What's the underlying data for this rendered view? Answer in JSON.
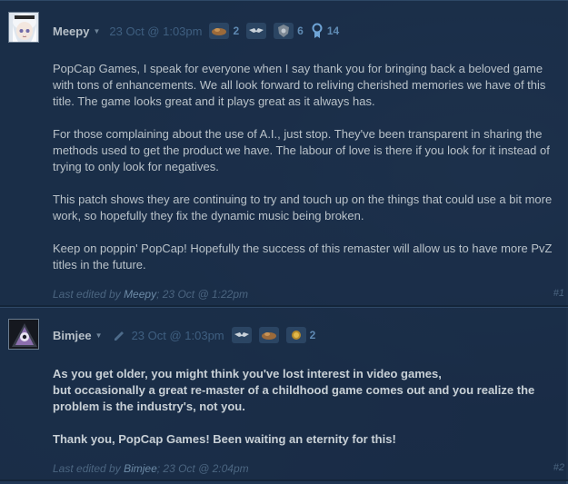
{
  "posts": [
    {
      "author": "Meepy",
      "date": "23 Oct @ 1:03pm",
      "badges": [
        {
          "icon": "rock-icon",
          "count": "2"
        },
        {
          "icon": "wing-icon",
          "count": ""
        },
        {
          "icon": "shield-icon",
          "count": "6"
        },
        {
          "icon": "award-icon",
          "count": "14"
        }
      ],
      "paragraphs": [
        "PopCap Games, I speak for everyone when I say thank you for bringing back a beloved game with tons of enhancements. We all look forward to reliving cherished memories we have of this title. The game looks great and it plays great as it always has.",
        "For those complaining about the use of A.I., just stop. They've been transparent in sharing the methods used to get the product we have. The labour of love is there if you look for it instead of trying to only look for negatives.",
        "This patch shows they are continuing to try and touch up on the things that could use a bit more work, so hopefully they fix the dynamic music being broken.",
        "Keep on poppin' PopCap! Hopefully the success of this remaster will allow us to have more PvZ titles in the future."
      ],
      "edited_prefix": "Last edited by",
      "edited_by": "Meepy",
      "edited_date": "; 23 Oct @ 1:22pm",
      "number": "#1"
    },
    {
      "author": "Bimjee",
      "date": "23 Oct @ 1:03pm",
      "badges": [
        {
          "icon": "wing-icon",
          "count": ""
        },
        {
          "icon": "rock-icon",
          "count": ""
        },
        {
          "icon": "gold-coin-icon",
          "count": "2"
        }
      ],
      "paragraphs": [
        "As you get older, you might think you've lost interest in video games,\nbut occasionally a great re-master of a childhood game comes out and you realize the problem is the industry's, not you.",
        "Thank you, PopCap Games! Been waiting an eternity for this!"
      ],
      "edited_prefix": "Last edited by",
      "edited_by": "Bimjee",
      "edited_date": "; 23 Oct @ 2:04pm",
      "number": "#2"
    }
  ]
}
